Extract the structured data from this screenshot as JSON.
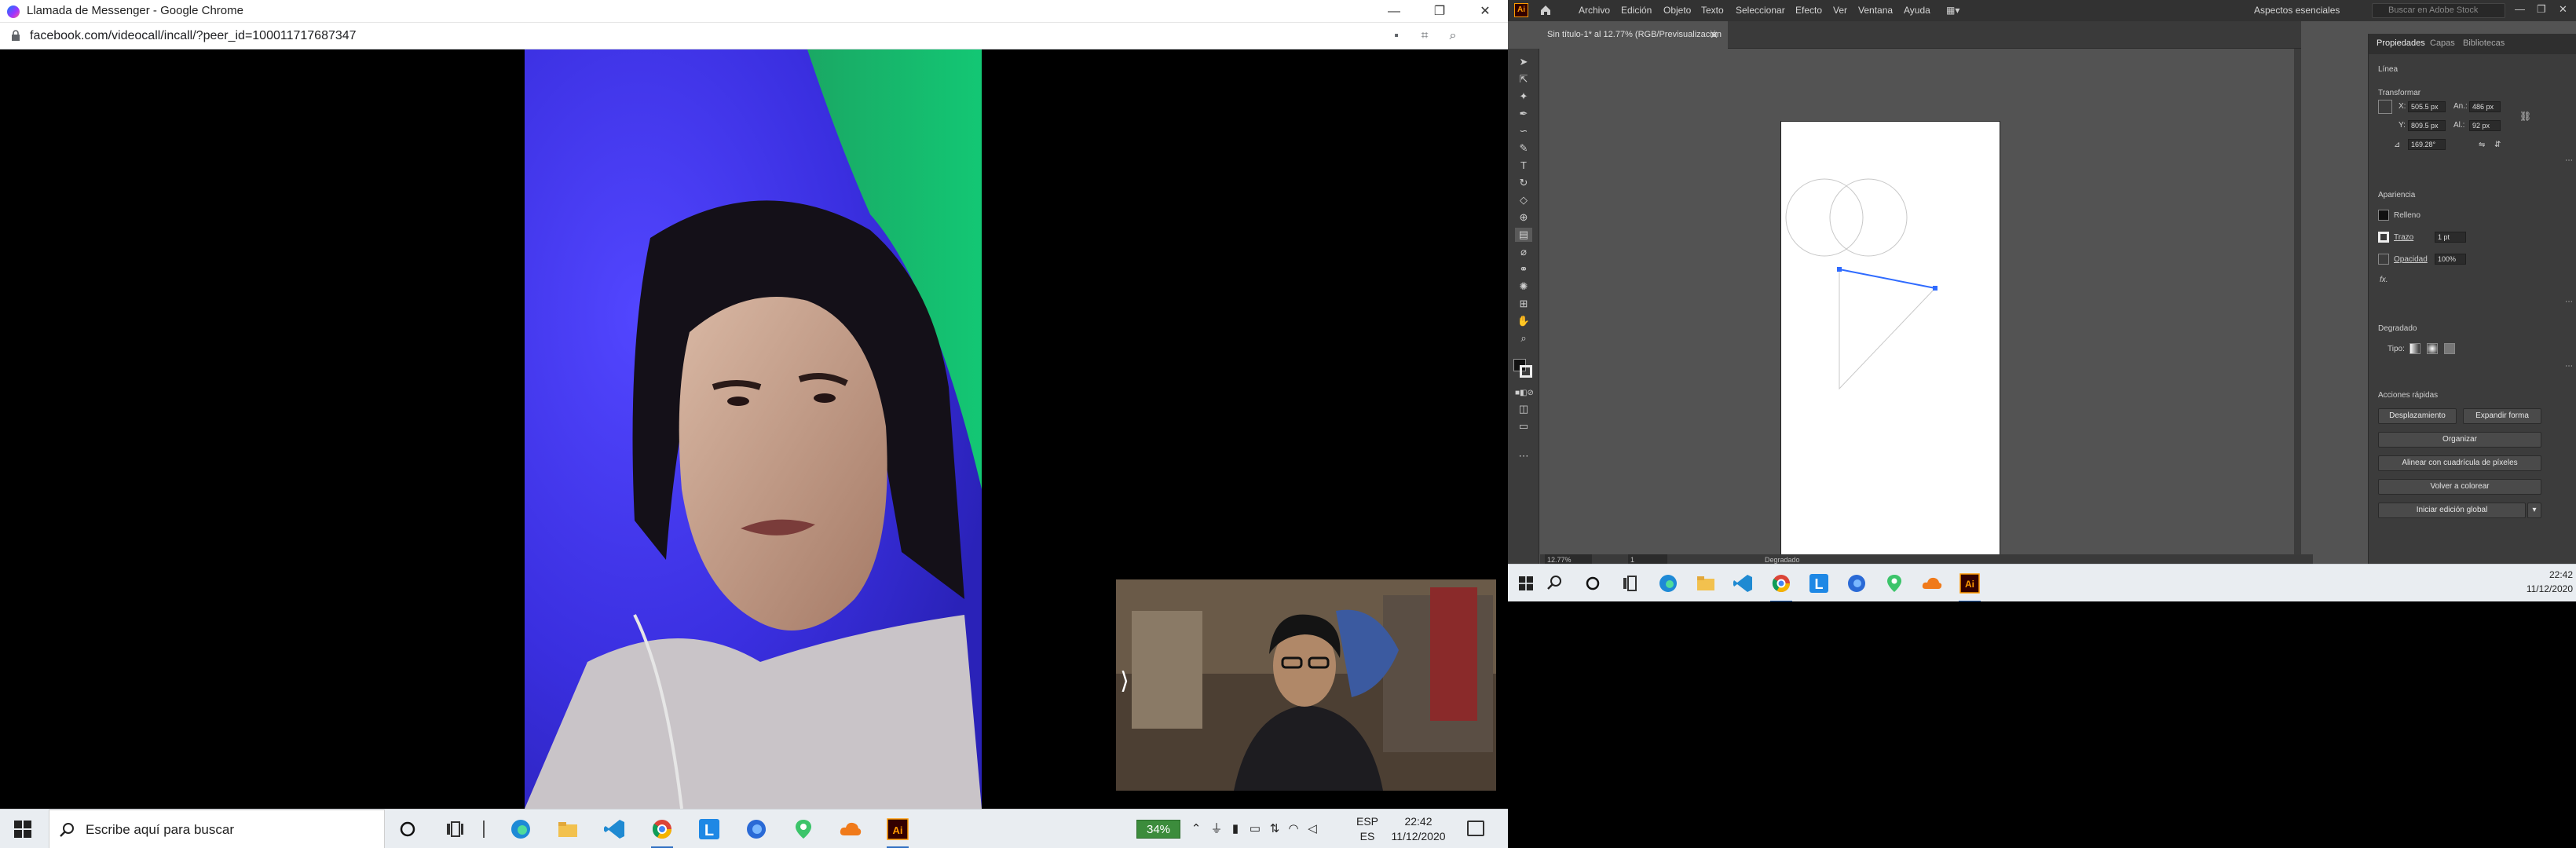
{
  "chrome": {
    "window_title": "Llamada de Messenger - Google Chrome",
    "url": "facebook.com/videocall/incall/?peer_id=100011717687347",
    "minimize": "—",
    "maximize": "❐",
    "close": "✕",
    "self_view_toggle": "⟩"
  },
  "taskbar_left": {
    "search_placeholder": "Escribe aquí para buscar",
    "battery": "34%",
    "lang_line1": "ESP",
    "lang_line2": "ES",
    "time": "22:42",
    "date": "11/12/2020"
  },
  "illustrator": {
    "logo": "Ai",
    "menus": [
      "Archivo",
      "Edición",
      "Objeto",
      "Texto",
      "Seleccionar",
      "Efecto",
      "Ver",
      "Ventana",
      "Ayuda"
    ],
    "workspace": "Aspectos esenciales",
    "stock_search": "Buscar en Adobe Stock",
    "doc_tab": "Sin título-1* al 12.77% (RGB/Previsualización de GPU)",
    "doc_close": "✕",
    "status_zoom": "12.77%",
    "status_artboard": "1",
    "status_tool": "Degradado",
    "panel": {
      "tabs": [
        "Propiedades",
        "Capas",
        "Bibliotecas"
      ],
      "object_type": "Línea",
      "transform_title": "Transformar",
      "x_label": "X:",
      "x_value": "505.5 px",
      "y_label": "Y:",
      "y_value": "809.5 px",
      "w_label": "An.:",
      "w_value": "486 px",
      "h_label": "Al.:",
      "h_value": "92 px",
      "angle_value": "169.28°",
      "appearance_title": "Apariencia",
      "fill_label": "Relleno",
      "stroke_label": "Trazo",
      "stroke_value": "1 pt",
      "opacity_label": "Opacidad",
      "opacity_value": "100%",
      "fx_label": "fx.",
      "gradient_title": "Degradado",
      "gradient_type_label": "Tipo:",
      "quick_actions_title": "Acciones rápidas",
      "btn_offset": "Desplazamiento",
      "btn_expand": "Expandir forma",
      "btn_arrange": "Organizar",
      "btn_align_pixel": "Alinear con cuadrícula de píxeles",
      "btn_recolor": "Volver a colorear",
      "btn_global_edit": "Iniciar edición global"
    }
  },
  "taskbar_right": {
    "time": "22:42",
    "date": "11/12/2020"
  },
  "colors": {
    "ai_dark": "#323232",
    "ai_canvas": "#535353",
    "selection_blue": "#2f6bff",
    "battery_green": "#3c8c3c"
  },
  "icons": {
    "tray": [
      "chevron-up-icon",
      "usb-icon",
      "microphone-icon",
      "battery-icon",
      "network-icon",
      "wifi-icon",
      "volume-icon"
    ]
  }
}
